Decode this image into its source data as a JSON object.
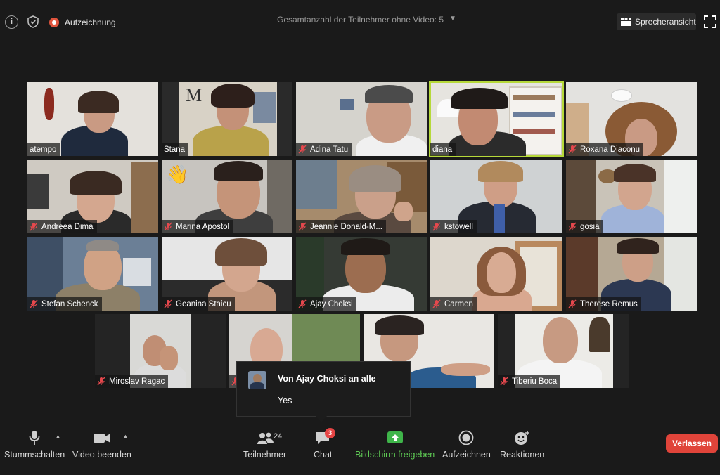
{
  "header": {
    "info_icon": "info-icon",
    "shield_icon": "shield-icon",
    "recording_label": "Aufzeichnung",
    "title": "Gesamtanzahl der Teilnehmer ohne Video: 5",
    "speaker_view_label": "Sprecheransicht",
    "fullscreen_icon": "fullscreen-icon"
  },
  "participants": [
    {
      "name": "atempo",
      "muted": false
    },
    {
      "name": "Stana",
      "muted": false
    },
    {
      "name": "Adina Tatu",
      "muted": true
    },
    {
      "name": "diana",
      "muted": false,
      "active_speaker": true
    },
    {
      "name": "Roxana Diaconu",
      "muted": true
    },
    {
      "name": "Andreea Dima",
      "muted": true
    },
    {
      "name": "Marina Apostol",
      "muted": true,
      "reaction": "waving-hand"
    },
    {
      "name": "Jeannie Donald-M...",
      "muted": true
    },
    {
      "name": "kstowell",
      "muted": true
    },
    {
      "name": "gosia",
      "muted": true
    },
    {
      "name": "Stefan Schenck",
      "muted": true
    },
    {
      "name": "Geanina Staicu",
      "muted": true
    },
    {
      "name": "Ajay Choksi",
      "muted": true
    },
    {
      "name": "Carmen",
      "muted": true
    },
    {
      "name": "Therese Remus",
      "muted": true
    },
    {
      "name": "Miroslav Ragac",
      "muted": true
    },
    {
      "name": "",
      "muted": true
    },
    {
      "name": "",
      "muted": false
    },
    {
      "name": "",
      "muted": false
    },
    {
      "name": "Tiberiu Boca",
      "muted": true
    }
  ],
  "chat_popup": {
    "from": "Von Ajay Choksi an alle",
    "message": "Yes"
  },
  "toolbar": {
    "mute_label": "Stummschalten",
    "video_label": "Video beenden",
    "participants_label": "Teilnehmer",
    "participants_count": "24",
    "chat_label": "Chat",
    "chat_badge": "3",
    "share_label": "Bildschirm freigeben",
    "record_label": "Aufzeichnen",
    "reactions_label": "Reaktionen",
    "leave_label": "Verlassen"
  },
  "colors": {
    "background": "#1a1a1a",
    "active_speaker_border": "#b6d93a",
    "share_green": "#5fcb55",
    "leave_red": "#e0443a",
    "recording_red": "#e0543d"
  }
}
